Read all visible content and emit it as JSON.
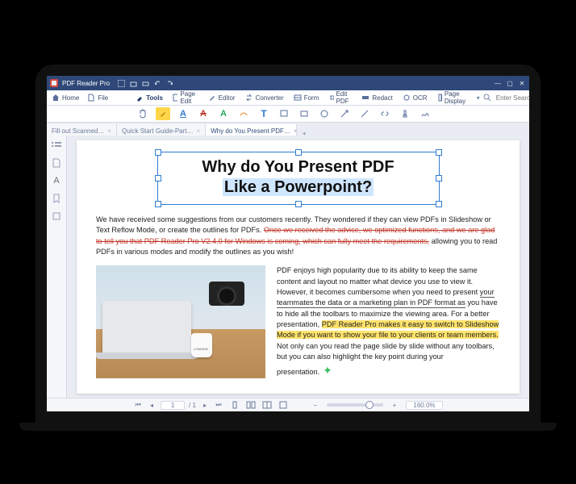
{
  "app": {
    "name": "PDF Reader Pro"
  },
  "window": {
    "minimize": "—",
    "maximize": "▢",
    "close": "✕"
  },
  "ribbon": {
    "home": "Home",
    "file": "File",
    "items": [
      {
        "label": "Tools"
      },
      {
        "label": "Page Edit"
      },
      {
        "label": "Editor"
      },
      {
        "label": "Converter"
      },
      {
        "label": "Form"
      },
      {
        "label": "Edit PDF"
      },
      {
        "label": "Redact"
      },
      {
        "label": "OCR"
      },
      {
        "label": "Page Display"
      }
    ],
    "search_placeholder": "Enter Search Text"
  },
  "tabs": [
    {
      "label": "Fill out Scanned…"
    },
    {
      "label": "Quick Start Guide-Part…"
    },
    {
      "label": "Why do You Present  PDF…"
    }
  ],
  "doc": {
    "title_line1": "Why do You Present PDF",
    "title_line2": "Like a Powerpoint?",
    "p1_a": "We have received some suggestions from our customers recently. They wondered if they can view PDFs in Slideshow or Text Reflow Mode, or create the outlines for PDFs. ",
    "p1_strike": "Once we received the advice, we optimized functions, and we are glad to tell you that PDF Reader Pro V2.4.0 for Windows is coming, which can fully meet the requirements,",
    "p1_b": " allowing you to read PDFs in various modes and modify the outlines as you wish!",
    "p2_a": "PDF enjoys high popularity due to its ability to keep the same content and layout no matter what device you use to view it. However, it becomes cumbersome when you need to present ",
    "p2_und": "your teammates the data or a marketing plan in PDF format as",
    "p2_b": " you have to hide all the toolbars to maximize the viewing area. For a better presentation, ",
    "p2_hl": "PDF Reader Pro makes it easy to switch to Slideshow Mode if you want to show your file to your clients or team members.",
    "p2_c": " Not only can you read the page slide by slide without any toolbars, but you can also highlight the key point during your presentation.",
    "mug": "LOADING"
  },
  "status": {
    "page_current": "1",
    "page_total": "/ 1",
    "zoom": "160.0%",
    "zoom_minus": "−",
    "zoom_plus": "+"
  }
}
